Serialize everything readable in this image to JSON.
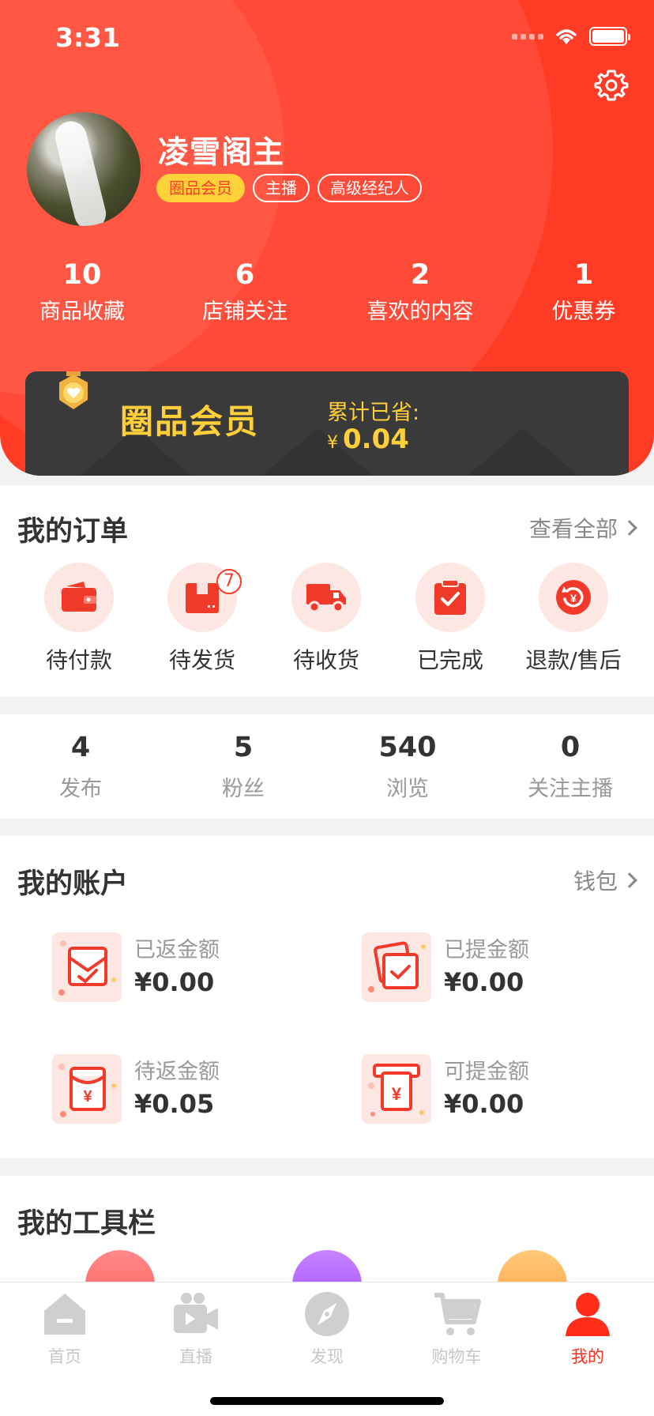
{
  "status_bar": {
    "time": "3:31"
  },
  "profile": {
    "name": "凌雪阁主",
    "tags": [
      "圈品会员",
      "主播",
      "高级经纪人"
    ]
  },
  "top_stats": [
    {
      "value": "10",
      "label": "商品收藏"
    },
    {
      "value": "6",
      "label": "店铺关注"
    },
    {
      "value": "2",
      "label": "喜欢的内容"
    },
    {
      "value": "1",
      "label": "优惠券"
    }
  ],
  "vip": {
    "title": "圈品会员",
    "saved_label": "累计已省:",
    "currency": "¥",
    "saved_amount": "0.04"
  },
  "orders": {
    "title": "我的订单",
    "link": "查看全部",
    "items": [
      {
        "label": "待付款",
        "icon": "wallet-icon"
      },
      {
        "label": "待发货",
        "icon": "package-icon",
        "badge": "7"
      },
      {
        "label": "待收货",
        "icon": "truck-icon"
      },
      {
        "label": "已完成",
        "icon": "clipboard-check-icon"
      },
      {
        "label": "退款/售后",
        "icon": "refund-icon"
      }
    ]
  },
  "activity_stats": [
    {
      "value": "4",
      "label": "发布"
    },
    {
      "value": "5",
      "label": "粉丝"
    },
    {
      "value": "540",
      "label": "浏览"
    },
    {
      "value": "0",
      "label": "关注主播"
    }
  ],
  "account": {
    "title": "我的账户",
    "link": "钱包",
    "items": [
      {
        "label": "已返金额",
        "value": "¥0.00",
        "icon": "envelope-check-icon"
      },
      {
        "label": "已提金额",
        "value": "¥0.00",
        "icon": "cards-check-icon"
      },
      {
        "label": "待返金额",
        "value": "¥0.05",
        "icon": "red-envelope-yen-icon"
      },
      {
        "label": "可提金额",
        "value": "¥0.00",
        "icon": "atm-yen-icon"
      }
    ]
  },
  "tools": {
    "title": "我的工具栏"
  },
  "tabbar": [
    {
      "label": "首页",
      "icon": "home-icon",
      "active": false
    },
    {
      "label": "直播",
      "icon": "video-camera-icon",
      "active": false
    },
    {
      "label": "发现",
      "icon": "compass-icon",
      "active": false
    },
    {
      "label": "购物车",
      "icon": "cart-icon",
      "active": false
    },
    {
      "label": "我的",
      "icon": "person-icon",
      "active": true
    }
  ],
  "colors": {
    "brand_red": "#ff3a25",
    "gold": "#ffcf3a",
    "vip_dark": "#3a3a3a"
  }
}
